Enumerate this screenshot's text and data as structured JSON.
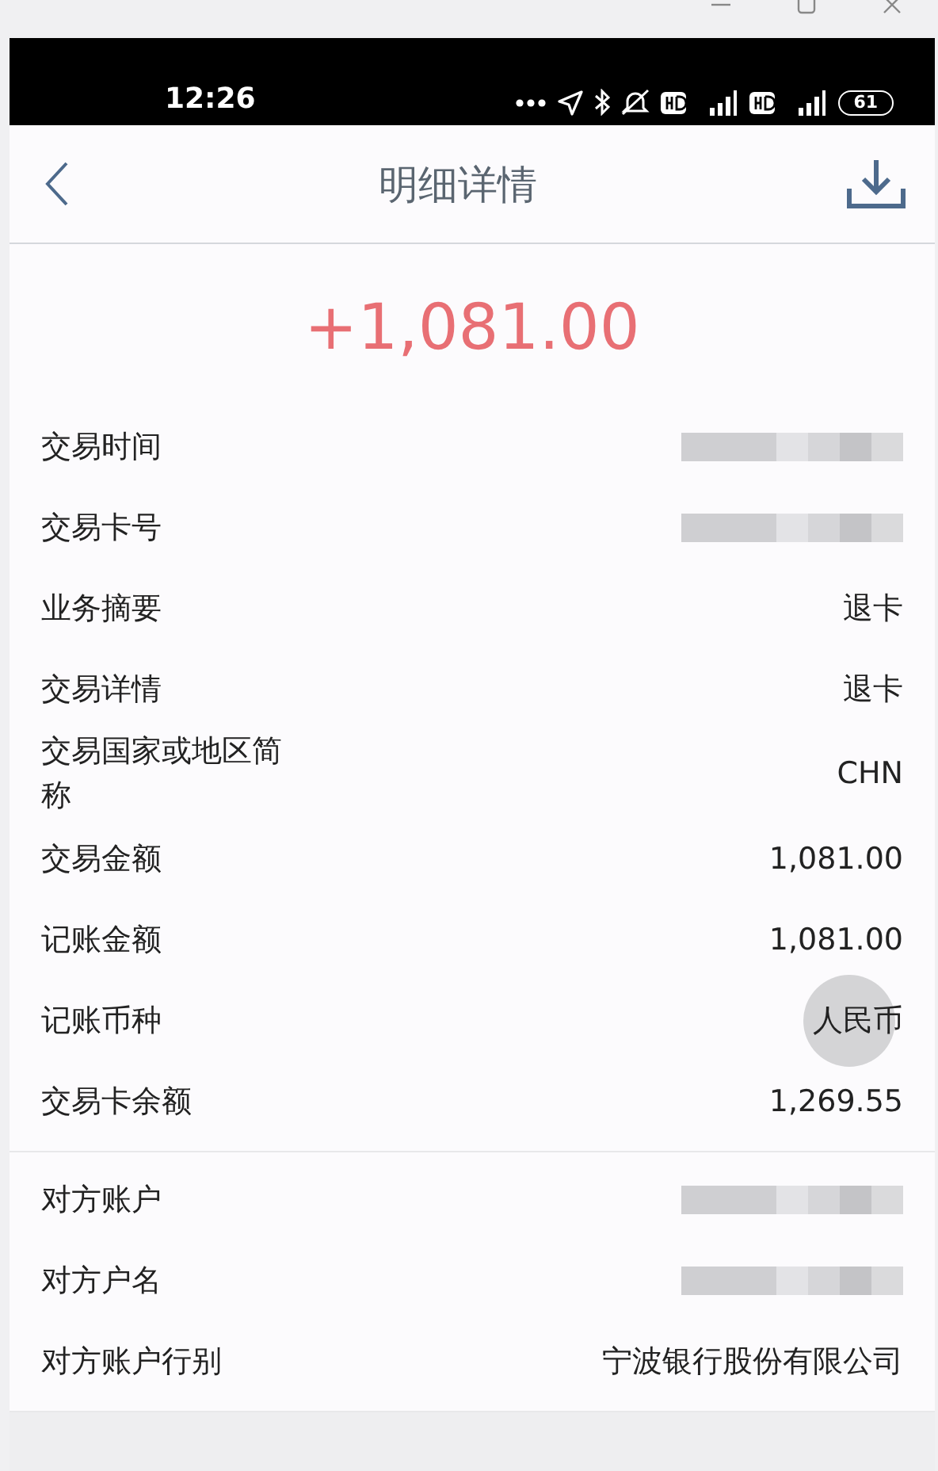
{
  "status_bar": {
    "time": "12:26",
    "battery": "61"
  },
  "header": {
    "title": "明细详情"
  },
  "amount": "+1,081.00",
  "sections": [
    {
      "rows": [
        {
          "label": "交易时间",
          "kind": "masked"
        },
        {
          "label": "交易卡号",
          "kind": "masked"
        },
        {
          "label": "业务摘要",
          "kind": "text",
          "value": "退卡"
        },
        {
          "label": "交易详情",
          "kind": "text",
          "value": "退卡"
        },
        {
          "label": "交易国家或地区简称",
          "kind": "text",
          "value": "CHN"
        },
        {
          "label": "交易金额",
          "kind": "text",
          "value": "1,081.00"
        },
        {
          "label": "记账金额",
          "kind": "text",
          "value": "1,081.00"
        },
        {
          "label": "记账币种",
          "kind": "text",
          "value": "人民币",
          "touched": true
        },
        {
          "label": "交易卡余额",
          "kind": "text",
          "value": "1,269.55"
        }
      ]
    },
    {
      "rows": [
        {
          "label": "对方账户",
          "kind": "masked"
        },
        {
          "label": "对方户名",
          "kind": "masked"
        },
        {
          "label": "对方账户行别",
          "kind": "text",
          "value": "宁波银行股份有限公司"
        }
      ]
    }
  ]
}
